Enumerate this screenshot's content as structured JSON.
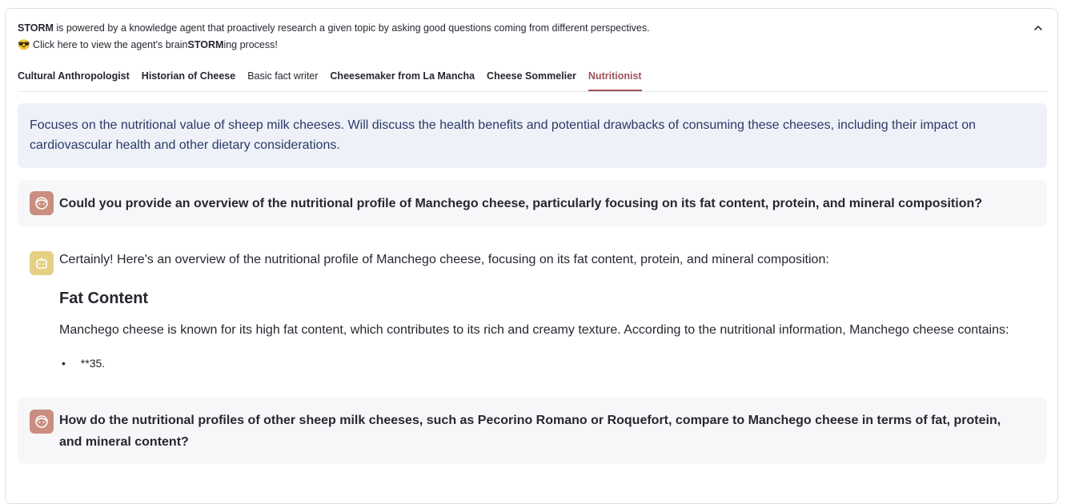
{
  "header": {
    "intro_brand": "STORM",
    "intro_rest": " is powered by a knowledge agent that proactively research a given topic by asking good questions coming from different perspectives.",
    "click_emoji": "😎",
    "click_pre": " Click here to view the agent's brain",
    "click_brand": "STORM",
    "click_post": "ing process!"
  },
  "tabs": [
    {
      "label": "Cultural Anthropologist",
      "active": false
    },
    {
      "label": "Historian of Cheese",
      "active": false
    },
    {
      "label": "Basic fact writer",
      "active": false
    },
    {
      "label": "Cheesemaker from La Mancha",
      "active": false
    },
    {
      "label": "Cheese Sommelier",
      "active": false
    },
    {
      "label": "Nutritionist",
      "active": true
    }
  ],
  "perspective_description": "Focuses on the nutritional value of sheep milk cheeses. Will discuss the health benefits and potential drawbacks of consuming these cheeses, including their impact on cardiovascular health and other dietary considerations.",
  "conversation": {
    "q1": "Could you provide an overview of the nutritional profile of Manchego cheese, particularly focusing on its fat content, protein, and mineral composition?",
    "a1_intro": "Certainly! Here's an overview of the nutritional profile of Manchego cheese, focusing on its fat content, protein, and mineral composition:",
    "a1_heading": "Fat Content",
    "a1_paragraph": "Manchego cheese is known for its high fat content, which contributes to its rich and creamy texture. According to the nutritional information, Manchego cheese contains:",
    "a1_bullet": "**35.",
    "q2": "How do the nutritional profiles of other sheep milk cheeses, such as Pecorino Romano or Roquefort, compare to Manchego cheese in terms of fat, protein, and mineral content?"
  },
  "colors": {
    "accent": "#a0525a",
    "info_bg": "#eef1f8",
    "user_avatar": "#c98e7f",
    "assistant_avatar": "#e5cf85"
  }
}
